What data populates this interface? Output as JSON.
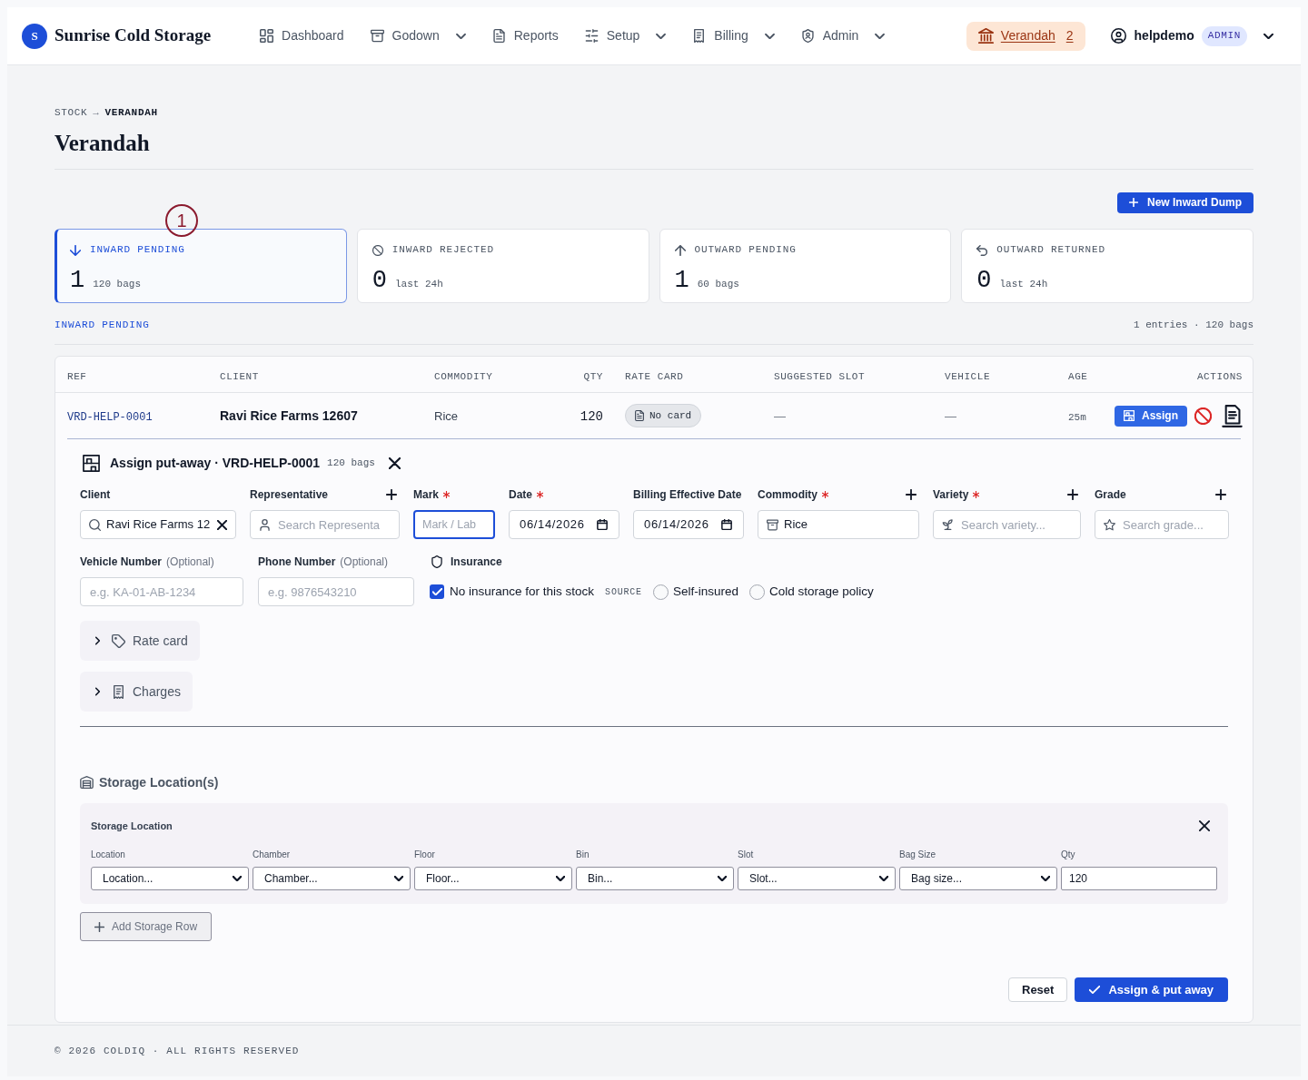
{
  "header": {
    "logo_letter": "S",
    "brand": "Sunrise Cold Storage",
    "nav": [
      {
        "label": "Dashboard",
        "dropdown": false
      },
      {
        "label": "Godown",
        "dropdown": true
      },
      {
        "label": "Reports",
        "dropdown": false
      },
      {
        "label": "Setup",
        "dropdown": true
      },
      {
        "label": "Billing",
        "dropdown": true
      },
      {
        "label": "Admin",
        "dropdown": true
      }
    ],
    "location": {
      "label": "Verandah",
      "count": "2"
    },
    "user": {
      "name": "helpdemo",
      "role": "ADMIN"
    }
  },
  "breadcrumb": {
    "items": [
      "STOCK",
      "VERANDAH"
    ],
    "separator": "→"
  },
  "page_title": "Verandah",
  "primary_action": "New Inward Dump",
  "stat_cards": [
    {
      "label": "INWARD PENDING",
      "count": "1",
      "caption": "120 bags",
      "selected": true
    },
    {
      "label": "INWARD REJECTED",
      "count": "0",
      "caption": "last 24h",
      "selected": false
    },
    {
      "label": "OUTWARD PENDING",
      "count": "1",
      "caption": "60 bags",
      "selected": false
    },
    {
      "label": "OUTWARD RETURNED",
      "count": "0",
      "caption": "last 24h",
      "selected": false
    }
  ],
  "callout_marker": "1",
  "section": {
    "title": "INWARD PENDING",
    "summary": "1 entries · 120 bags"
  },
  "table": {
    "columns": [
      "REF",
      "CLIENT",
      "COMMODITY",
      "QTY",
      "RATE CARD",
      "SUGGESTED SLOT",
      "VEHICLE",
      "AGE",
      "ACTIONS"
    ],
    "rows": [
      {
        "ref": "VRD-HELP-0001",
        "client": "Ravi Rice Farms 12607",
        "commodity": "Rice",
        "qty": "120",
        "rate_card": "No card",
        "suggested_slot": "—",
        "vehicle": "—",
        "age": "25m",
        "assign_label": "Assign",
        "expanded": true,
        "assign_form": {
          "title": "Assign put-away · VRD-HELP-0001",
          "bags": "120 bags",
          "fields": [
            {
              "kind": "lookup",
              "label": "Client",
              "required": false,
              "addable": false,
              "focused": false,
              "clearable": true,
              "value": "Ravi Rice Farms 12"
            },
            {
              "kind": "lookup",
              "label": "Representative",
              "required": false,
              "addable": true,
              "focused": false,
              "clearable": false,
              "placeholder": "Search Representa"
            },
            {
              "kind": "text",
              "label": "Mark",
              "required": true,
              "addable": false,
              "focused": true,
              "clearable": false,
              "placeholder": "Mark / Lab"
            },
            {
              "kind": "date",
              "label": "Date",
              "required": true,
              "addable": false,
              "focused": false,
              "clearable": false,
              "value": "06/14/2026"
            },
            {
              "kind": "date",
              "label": "Billing Effective Date",
              "required": false,
              "addable": false,
              "focused": false,
              "clearable": false,
              "value": "06/14/2026"
            },
            {
              "kind": "lookup",
              "label": "Commodity",
              "required": true,
              "addable": true,
              "focused": false,
              "clearable": false,
              "value": "Rice"
            },
            {
              "kind": "lookup",
              "label": "Variety",
              "required": true,
              "addable": true,
              "focused": false,
              "clearable": false,
              "placeholder": "Search variety..."
            },
            {
              "kind": "lookup",
              "label": "Grade",
              "required": false,
              "addable": true,
              "focused": false,
              "clearable": false,
              "placeholder": "Search grade..."
            }
          ],
          "contact_fields": [
            {
              "label": "Vehicle Number",
              "hint": "(Optional)",
              "placeholder": "e.g. KA-01-AB-1234"
            },
            {
              "label": "Phone Number",
              "hint": "(Optional)",
              "placeholder": "e.g. 9876543210"
            }
          ],
          "insurance": {
            "label": "Insurance",
            "opt_out": {
              "label": "No insurance for this stock",
              "checked": true
            },
            "source_label": "SOURCE",
            "sources": [
              {
                "label": "Self-insured",
                "selected": false
              },
              {
                "label": "Cold storage policy",
                "selected": false
              }
            ]
          },
          "sections": [
            {
              "label": "Rate card",
              "expanded": false
            },
            {
              "label": "Charges",
              "expanded": false
            }
          ],
          "storage": {
            "title": "Storage Location(s)",
            "rows": [
              {
                "title": "Storage Location",
                "fields": [
                  {
                    "kind": "select",
                    "label": "Location",
                    "value": "Location..."
                  },
                  {
                    "kind": "select",
                    "label": "Chamber",
                    "value": "Chamber..."
                  },
                  {
                    "kind": "select",
                    "label": "Floor",
                    "value": "Floor..."
                  },
                  {
                    "kind": "select",
                    "label": "Bin",
                    "value": "Bin..."
                  },
                  {
                    "kind": "select",
                    "label": "Slot",
                    "value": "Slot..."
                  },
                  {
                    "kind": "select",
                    "label": "Bag Size",
                    "value": "Bag size..."
                  },
                  {
                    "kind": "input",
                    "label": "Qty",
                    "value": "120"
                  }
                ]
              }
            ],
            "add_label": "Add Storage Row"
          },
          "actions": {
            "reset": "Reset",
            "submit": "Assign & put away"
          }
        }
      }
    ]
  },
  "footer": "© 2026 COLDIQ · ALL RIGHTS RESERVED"
}
